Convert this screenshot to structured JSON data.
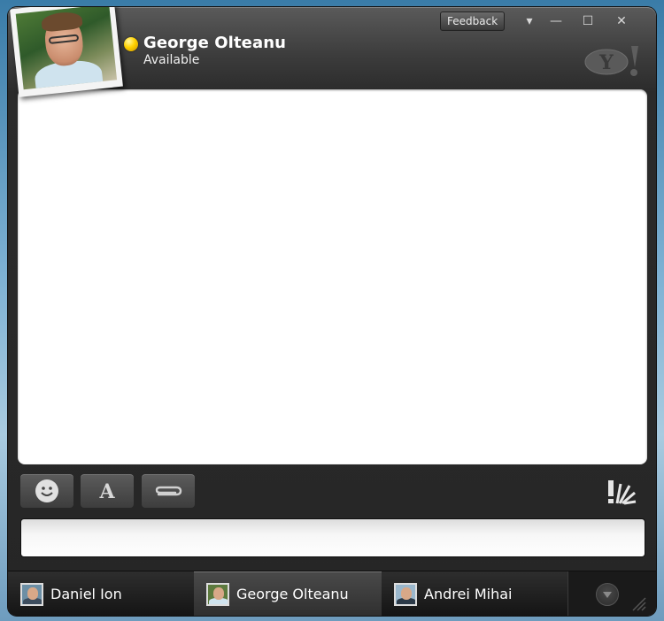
{
  "window": {
    "feedback_label": "Feedback",
    "controls": {
      "dropdown": "▾",
      "minimize": "—",
      "maximize": "☐",
      "close": "✕"
    }
  },
  "contact": {
    "name": "George Olteanu",
    "status": "Available",
    "status_color": "#ffd200"
  },
  "toolbar": {
    "items": [
      {
        "icon": "smiley-icon"
      },
      {
        "icon": "font-icon"
      },
      {
        "icon": "paperclip-icon"
      }
    ],
    "buzz_icon": "buzz-icon"
  },
  "tabs": [
    {
      "label": "Daniel Ion",
      "active": false
    },
    {
      "label": "George Olteanu",
      "active": true
    },
    {
      "label": "Andrei Mihai",
      "active": false
    }
  ],
  "colors": {
    "chrome": "#262626",
    "chat_bg": "#ffffff"
  }
}
